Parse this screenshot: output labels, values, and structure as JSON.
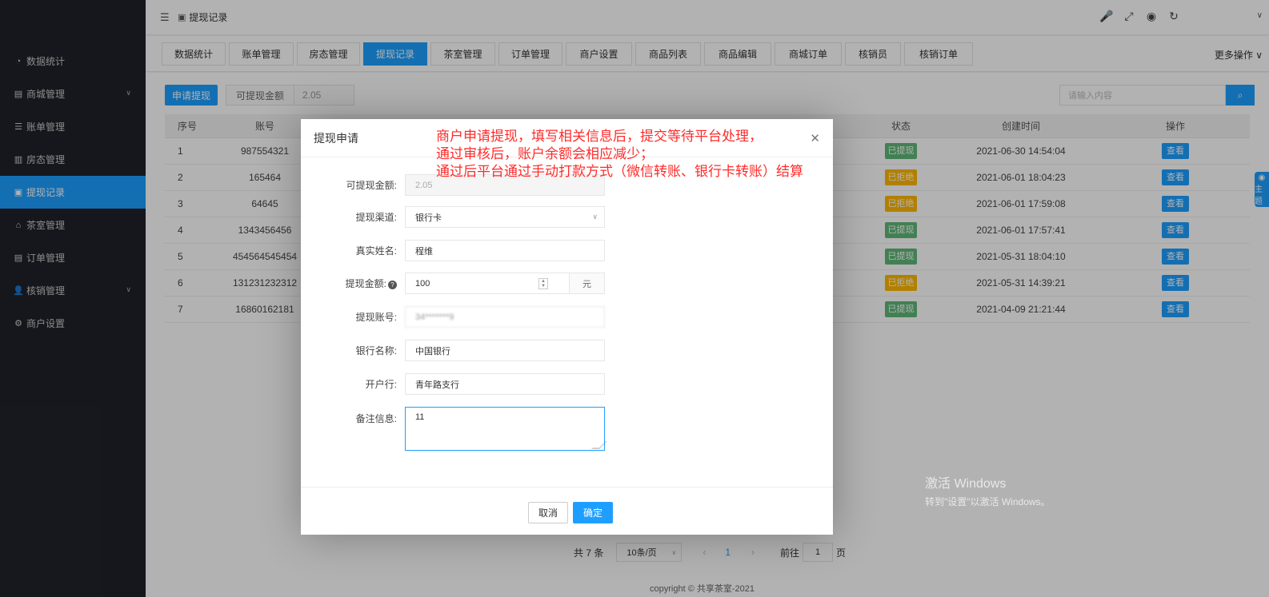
{
  "sidebar": {
    "items": [
      {
        "label": "数据统计",
        "icon": "dashboard-icon",
        "glyph": "◔"
      },
      {
        "label": "商城管理",
        "icon": "shop-icon",
        "glyph": "▤",
        "has_submenu": true
      },
      {
        "label": "账单管理",
        "icon": "list-icon",
        "glyph": "☰"
      },
      {
        "label": "房态管理",
        "icon": "building-icon",
        "glyph": "▥"
      },
      {
        "label": "提现记录",
        "icon": "cash-icon",
        "glyph": "▣",
        "active": true
      },
      {
        "label": "茶室管理",
        "icon": "home-icon",
        "glyph": "⌂"
      },
      {
        "label": "订单管理",
        "icon": "order-icon",
        "glyph": "▤"
      },
      {
        "label": "核销管理",
        "icon": "user-icon",
        "glyph": "👤",
        "has_submenu": true
      },
      {
        "label": "商户设置",
        "icon": "gear-icon",
        "glyph": "⚙"
      }
    ]
  },
  "header": {
    "breadcrumb": "提现记录",
    "menu_glyph": "☰",
    "crumb_glyph": "▣",
    "tool_glyphs": {
      "mute": "🎤",
      "fullscreen": "⤢",
      "theme": "◉",
      "refresh": "↻"
    },
    "chevron": "∨"
  },
  "tabs": [
    "数据统计",
    "账单管理",
    "房态管理",
    "提现记录",
    "茶室管理",
    "订单管理",
    "商户设置",
    "商品列表",
    "商品编辑",
    "商城订单",
    "核销员",
    "核销订单"
  ],
  "active_tab": 3,
  "more_ops": "更多操作",
  "toolbar": {
    "apply_button": "申请提现",
    "available_label": "可提现金额",
    "available_value": "2.05",
    "search_placeholder": "请输入内容",
    "search_glyph": "⌕"
  },
  "table": {
    "headers": {
      "index": "序号",
      "account": "账号",
      "status": "状态",
      "created": "创建时间",
      "ops": "操作"
    },
    "rows": [
      {
        "index": "1",
        "account": "987554321",
        "status": "已提现",
        "status_color": "green",
        "created": "2021-06-30 14:54:04",
        "op": "查看"
      },
      {
        "index": "2",
        "account": "165464",
        "status": "已拒绝",
        "status_color": "orange",
        "created": "2021-06-01 18:04:23",
        "op": "查看"
      },
      {
        "index": "3",
        "account": "64645",
        "status": "已拒绝",
        "status_color": "orange",
        "created": "2021-06-01 17:59:08",
        "op": "查看"
      },
      {
        "index": "4",
        "account": "1343456456",
        "status": "已提现",
        "status_color": "green",
        "created": "2021-06-01 17:57:41",
        "op": "查看"
      },
      {
        "index": "5",
        "account": "454564545454",
        "status": "已提现",
        "status_color": "green",
        "created": "2021-05-31 18:04:10",
        "op": "查看"
      },
      {
        "index": "6",
        "account": "131231232312",
        "status": "已拒绝",
        "status_color": "orange",
        "created": "2021-05-31 14:39:21",
        "op": "查看"
      },
      {
        "index": "7",
        "account": "16860162181",
        "status": "已提现",
        "status_color": "green",
        "created": "2021-04-09 21:21:44",
        "op": "查看"
      }
    ]
  },
  "pagination": {
    "total": "共 7 条",
    "page_size": "10条/页",
    "prev": "‹",
    "current": "1",
    "next": "›",
    "goto_label": "前往",
    "goto_value": "1",
    "page_suffix": "页"
  },
  "copyright": "copyright © 共享茶室-2021",
  "watermark": {
    "line1": "激活 Windows",
    "line2": "转到\"设置\"以激活 Windows。"
  },
  "side_widget": {
    "glyph": "◉",
    "label": "主题"
  },
  "modal": {
    "title": "提现申请",
    "close_glyph": "✕",
    "fields": {
      "available": {
        "label": "可提现金额:",
        "value": "2.05"
      },
      "channel": {
        "label": "提现渠道:",
        "value": "银行卡"
      },
      "real_name": {
        "label": "真实姓名:",
        "value": "程维"
      },
      "amount": {
        "label": "提现金额:",
        "value": "100",
        "unit": "元",
        "help": "?"
      },
      "account": {
        "label": "提现账号:",
        "value": "34*******9"
      },
      "bank_name": {
        "label": "银行名称:",
        "value": "中国银行"
      },
      "branch": {
        "label": "开户行:",
        "value": "青年路支行"
      },
      "remark": {
        "label": "备注信息:",
        "value": "11"
      }
    },
    "cancel": "取消",
    "confirm": "确定"
  },
  "annotation": {
    "line1": "商户申请提现，填写相关信息后，提交等待平台处理，",
    "line2": "通过审核后，账户余额会相应减少；",
    "line3": "通过后平台通过手动打款方式（微信转账、银行卡转账）结算"
  },
  "colors": {
    "primary": "#1e9fff",
    "sidebar": "#20222a",
    "success": "#5fb878",
    "warning": "#ffb800",
    "annotation": "#ff2b2b"
  }
}
